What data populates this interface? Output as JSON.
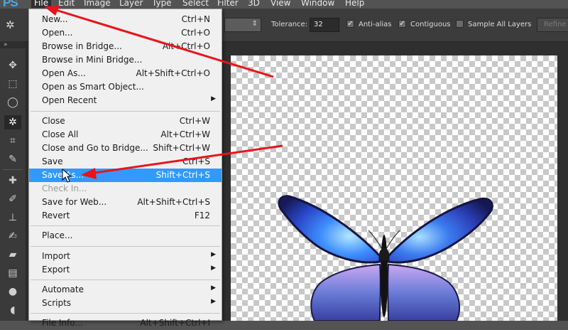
{
  "app": {
    "logo": "PS"
  },
  "menubar": {
    "items": [
      "File",
      "Edit",
      "Image",
      "Layer",
      "Type",
      "Select",
      "Filter",
      "3D",
      "View",
      "Window",
      "Help"
    ],
    "active": "File"
  },
  "options": {
    "tolerance_label": "Tolerance:",
    "tolerance_value": "32",
    "antialias_label": "Anti-alias",
    "antialias_checked": true,
    "contiguous_label": "Contiguous",
    "contiguous_checked": true,
    "sample_all_label": "Sample All Layers",
    "sample_all_checked": false,
    "refine_label": "Refine"
  },
  "toolbar": {
    "collapse_glyph": "»",
    "tools": [
      "move-tool",
      "marquee-tool",
      "lasso-tool",
      "magic-wand-tool",
      "crop-tool",
      "eyedropper-tool",
      "healing-brush-tool",
      "brush-tool",
      "clone-stamp-tool",
      "history-brush-tool",
      "eraser-tool",
      "gradient-tool",
      "blur-tool",
      "dodge-tool"
    ],
    "selected": "magic-wand-tool"
  },
  "file_menu": {
    "new": {
      "label": "New...",
      "shortcut": "Ctrl+N"
    },
    "open": {
      "label": "Open...",
      "shortcut": "Ctrl+O"
    },
    "browse_bridge": {
      "label": "Browse in Bridge...",
      "shortcut": "Alt+Ctrl+O"
    },
    "browse_mini": {
      "label": "Browse in Mini Bridge...",
      "shortcut": ""
    },
    "open_as": {
      "label": "Open As...",
      "shortcut": "Alt+Shift+Ctrl+O"
    },
    "open_smart": {
      "label": "Open as Smart Object...",
      "shortcut": ""
    },
    "open_recent": {
      "label": "Open Recent",
      "shortcut": ""
    },
    "close": {
      "label": "Close",
      "shortcut": "Ctrl+W"
    },
    "close_all": {
      "label": "Close All",
      "shortcut": "Alt+Ctrl+W"
    },
    "close_bridge": {
      "label": "Close and Go to Bridge...",
      "shortcut": "Shift+Ctrl+W"
    },
    "save": {
      "label": "Save",
      "shortcut": "Ctrl+S"
    },
    "save_as": {
      "label": "Save As...",
      "shortcut": "Shift+Ctrl+S"
    },
    "check_in": {
      "label": "Check In...",
      "shortcut": ""
    },
    "save_web": {
      "label": "Save for Web...",
      "shortcut": "Alt+Shift+Ctrl+S"
    },
    "revert": {
      "label": "Revert",
      "shortcut": "F12"
    },
    "place": {
      "label": "Place...",
      "shortcut": ""
    },
    "import": {
      "label": "Import",
      "shortcut": ""
    },
    "export": {
      "label": "Export",
      "shortcut": ""
    },
    "automate": {
      "label": "Automate",
      "shortcut": ""
    },
    "scripts": {
      "label": "Scripts",
      "shortcut": ""
    },
    "file_info": {
      "label": "File Info...",
      "shortcut": "Alt+Shift+Ctrl+I"
    },
    "submenu_glyph": "▶"
  },
  "colors": {
    "highlight": "#3399ff",
    "annotation_arrow": "#e8141c",
    "logo": "#4aa8e8"
  }
}
